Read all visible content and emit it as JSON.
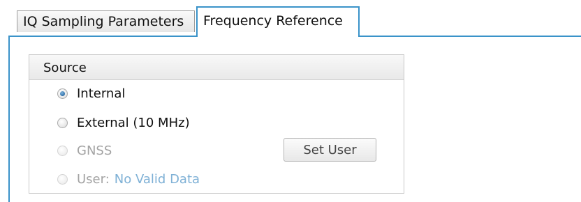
{
  "tabs": [
    {
      "label": "IQ Sampling Parameters",
      "active": false
    },
    {
      "label": "Frequency Reference",
      "active": true
    }
  ],
  "source_group": {
    "title": "Source",
    "options": [
      {
        "label": "Internal",
        "selected": true,
        "enabled": true
      },
      {
        "label": "External (10 MHz)",
        "selected": false,
        "enabled": true
      },
      {
        "label": "GNSS",
        "selected": false,
        "enabled": false
      },
      {
        "label": "User:",
        "value": "No Valid Data",
        "selected": false,
        "enabled": false
      }
    ],
    "set_user_button": "Set User"
  },
  "colors": {
    "tab_accent": "#3a93c9",
    "radio_selected": "#2f6fa7",
    "disabled_text": "#a3a3a3",
    "user_value_text": "#7fb1d6"
  }
}
